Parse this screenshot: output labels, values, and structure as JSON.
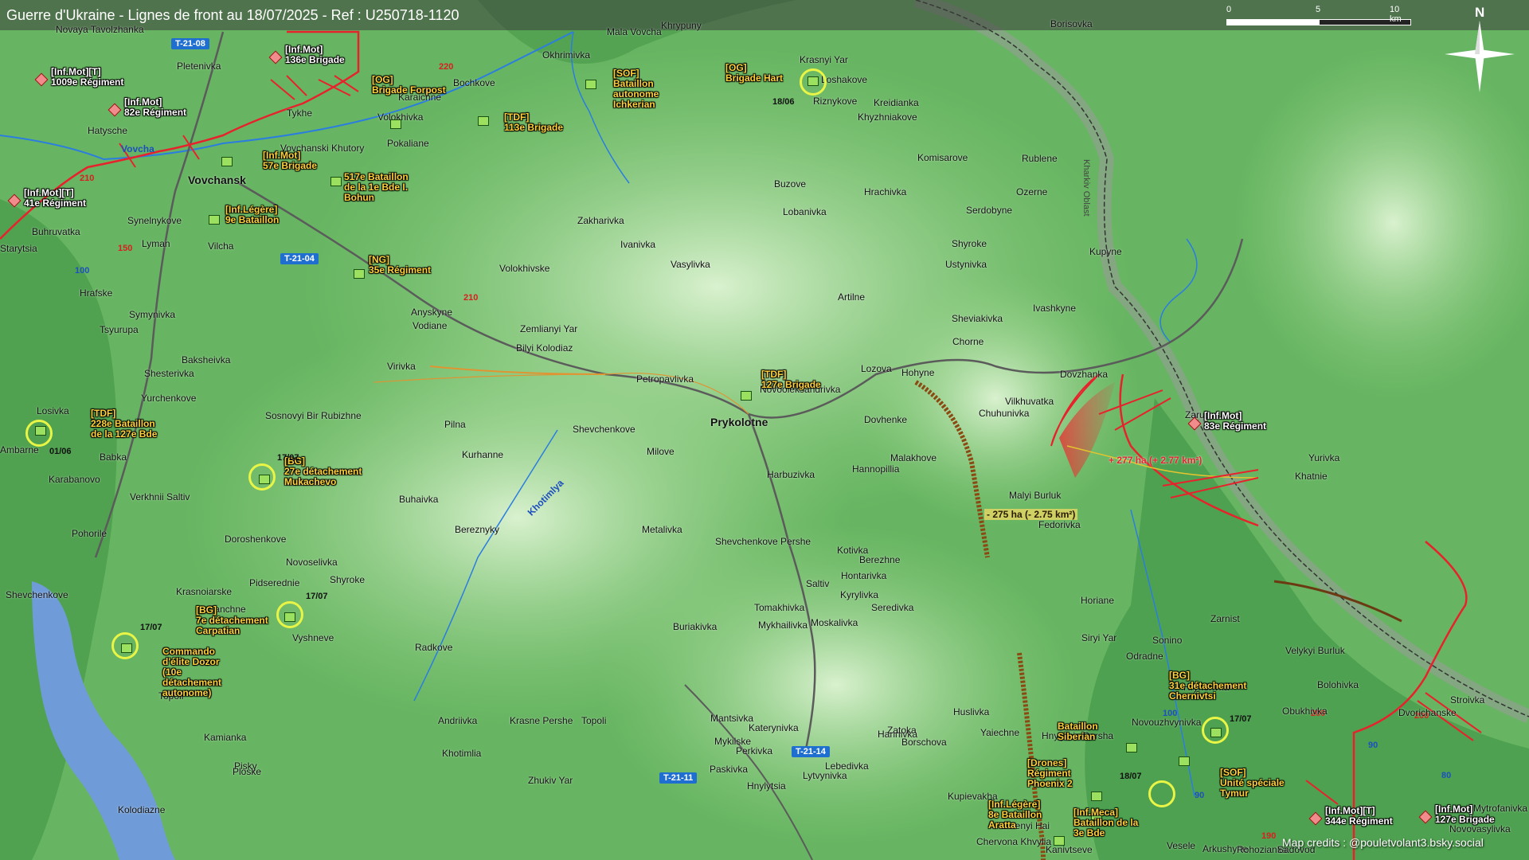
{
  "header": {
    "title": "Guerre d'Ukraine - Lignes de front au 18/07/2025 - Ref : U250718-1120"
  },
  "scale": {
    "labels": [
      "0",
      "5",
      "10 km"
    ]
  },
  "north": {
    "label": "N"
  },
  "oblast": "Kharkiv Oblast",
  "rivers": [
    "Vovcha",
    "Khotimlya"
  ],
  "credits": "Map credits : @pouletvolant3.bsky.social",
  "roads": [
    "T-21-08",
    "T-21-04",
    "T-21-11",
    "T-21-14"
  ],
  "road_numbers": [
    "210",
    "220",
    "150",
    "100",
    "210",
    "200",
    "190",
    "90",
    "80",
    "90",
    "100",
    "200"
  ],
  "towns": {
    "vovchansk": "Vovchansk",
    "prykolotne": "Prykolotne",
    "others": [
      "Novaya Tavolzhanka",
      "Pletenivka",
      "Hatysche",
      "Vovchanski Khutory",
      "Pokaliane",
      "Karaichne",
      "Volokhivka",
      "Bochkove",
      "Okhrimivka",
      "Mala Vovcha",
      "Khrypuny",
      "Krasnyi Yar",
      "Loshakove",
      "Riznykove",
      "Khyzhniakove",
      "Kreidianka",
      "Komisarove",
      "Rublene",
      "Ozerne",
      "Borisovka",
      "Tykhe",
      "Synelnykove",
      "Lyman",
      "Vilcha",
      "Buhruvatka",
      "Starytsia",
      "Hrafske",
      "Symynivka",
      "Tsyurupa",
      "Zakharivka",
      "Ivanivka",
      "Vasylivka",
      "Volokhivske",
      "Buzove",
      "Hrachivka",
      "Lobanivka",
      "Serdobyne",
      "Shyroke",
      "Ustynivka",
      "Kupyne",
      "Ivashkyne",
      "Artilne",
      "Sheviakivka",
      "Chorne",
      "Anyskyne",
      "Vodiane",
      "Zemlianyi Yar",
      "Bilyi Kolodiaz",
      "Baksheivka",
      "Virivka",
      "Shesterivka",
      "Yurchenkove",
      "Losivka",
      "Sosnovyi Bir",
      "Rubizhne",
      "Pilna",
      "Shevchenkove",
      "Petropavlivka",
      "Novooleksandrivka",
      "Lozova",
      "Hohyne",
      "Dovzhanka",
      "Vilkhuvatka",
      "Chuhunivka",
      "Zarubynka",
      "Dovhenke",
      "Milove",
      "Kurhanne",
      "Malakhove",
      "Hannopillia",
      "Harbuzivka",
      "Malyi Burluk",
      "Fedorivka",
      "Yurivka",
      "Khatnie",
      "Ambarne",
      "Babka",
      "Karabanovo",
      "Verkhnii Saltiv",
      "Buhaivka",
      "Bereznyky",
      "Metalivka",
      "Shevchenkove Pershe",
      "Kotivka",
      "Berezhne",
      "Pohorile",
      "Doroshenkove",
      "Pidserednie",
      "Novoselivka",
      "Shevchenkove",
      "Krasnoiarske",
      "Zanchne",
      "Vyshneve",
      "Radkove",
      "Shyroke",
      "Hontarivka",
      "Saltiv",
      "Kyrylivka",
      "Seredivka",
      "Tomakhivka",
      "Moskalivka",
      "Mykhailivka",
      "Buriakivka",
      "Horiane",
      "Zarnist",
      "Velykyi Burluk",
      "Siryi Yar",
      "Sonino",
      "Odradne",
      "Bolohivka",
      "Stroivka",
      "Hryhorivka",
      "Obukhivka",
      "Novouzhvynivka",
      "Dvorichanske",
      "Topoli",
      "Kolodiazne",
      "Kamianka",
      "Pisky",
      "Khotimlia",
      "Paskivka",
      "Hannivka",
      "Huslivka",
      "Hnylytsia Persha",
      "Yaiechne",
      "Ploske",
      "Zhukiv Yar",
      "Mantsivka",
      "Mykilske",
      "Katerynivka",
      "Perkivka",
      "Zatoka",
      "Borschova",
      "Hnylytsia",
      "Lebedivka",
      "Lytvynivka",
      "Kupievakha",
      "Zelenyi Hai",
      "Chervona Khvylia",
      "Kanivtseve",
      "Arkushyne",
      "Vesele",
      "Rohozianka",
      "Sadovod",
      "Mytrofanivka",
      "Novovasylivka",
      "Andriivka",
      "Krasne Pershe",
      "Topoli"
    ]
  },
  "units": {
    "ru": [
      {
        "label": "[Inf.Mot]\n136e Brigade"
      },
      {
        "label": "[Inf.Mot][T]\n1009e Régiment"
      },
      {
        "label": "[Inf.Mot]\n82e Régiment"
      },
      {
        "label": "[Inf.Mot][T]\n41e Régiment"
      },
      {
        "label": "[Inf.Mot]\n83e Régiment"
      },
      {
        "label": "[Inf.Mot][T]\n344e Régiment"
      },
      {
        "label": "[Inf.Mot]\n127e Brigade"
      }
    ],
    "ua": [
      {
        "label": "[OG]\nBrigade Forpost"
      },
      {
        "label": "[SOF]\nBataillon\nautonome\nIchkerian"
      },
      {
        "label": "[TDF]\n113e Brigade"
      },
      {
        "label": "[OG]\nBrigade Hart"
      },
      {
        "label": "[Inf.Mot]\n57e Brigade"
      },
      {
        "label": "517e Bataillon\nde la 1e Bde I.\nBohun"
      },
      {
        "label": "[Inf.Légère]\n9e Bataillon"
      },
      {
        "label": "[NG]\n35e Régiment"
      },
      {
        "label": "[TDF]\n127e Brigade"
      },
      {
        "label": "[TDF]\n228e Bataillon\nde la 127e Bde"
      },
      {
        "label": "[BG]\n27e détachement\nMukachevo"
      },
      {
        "label": "[BG]\n7e détachement\nCarpatian"
      },
      {
        "label": "Commando\nd'élite Dozor\n(10e\ndétachement\nautonome)"
      },
      {
        "label": "[BG]\n31e détachement\nChernivtsi"
      },
      {
        "label": "Bataillon\nSiberian"
      },
      {
        "label": "[Drones]\nRégiment\nPhoenix 2"
      },
      {
        "label": "[SOF]\nUnité spéciale\nTymur"
      },
      {
        "label": "[Inf.Légère]\n8e Bataillon\nAratta"
      },
      {
        "label": "[Inf.Meca]\nBataillon de la\n3e Bde"
      }
    ]
  },
  "dates": [
    "18/06",
    "01/06",
    "17/07",
    "17/07",
    "17/07",
    "17/07",
    "18/07"
  ],
  "changes": {
    "gain": "+ 277 ha (+ 2.77 km²)",
    "loss": "- 275 ha (- 2.75 km²)"
  }
}
